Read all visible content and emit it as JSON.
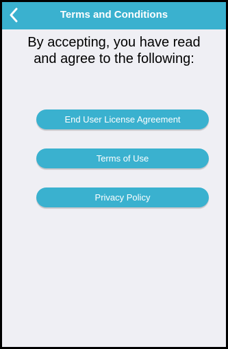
{
  "nav": {
    "title": "Terms and Conditions",
    "back_icon": "chevron-left-icon"
  },
  "intro": {
    "line1": "By accepting, you have read",
    "line2": "and agree to the following:"
  },
  "buttons": {
    "eula": "End User License Agreement",
    "terms": "Terms of Use",
    "privacy": "Privacy Policy"
  },
  "colors": {
    "accent": "#3ab1cf",
    "background": "#efeff4",
    "button_text": "#ffffff",
    "body_text": "#000000"
  }
}
